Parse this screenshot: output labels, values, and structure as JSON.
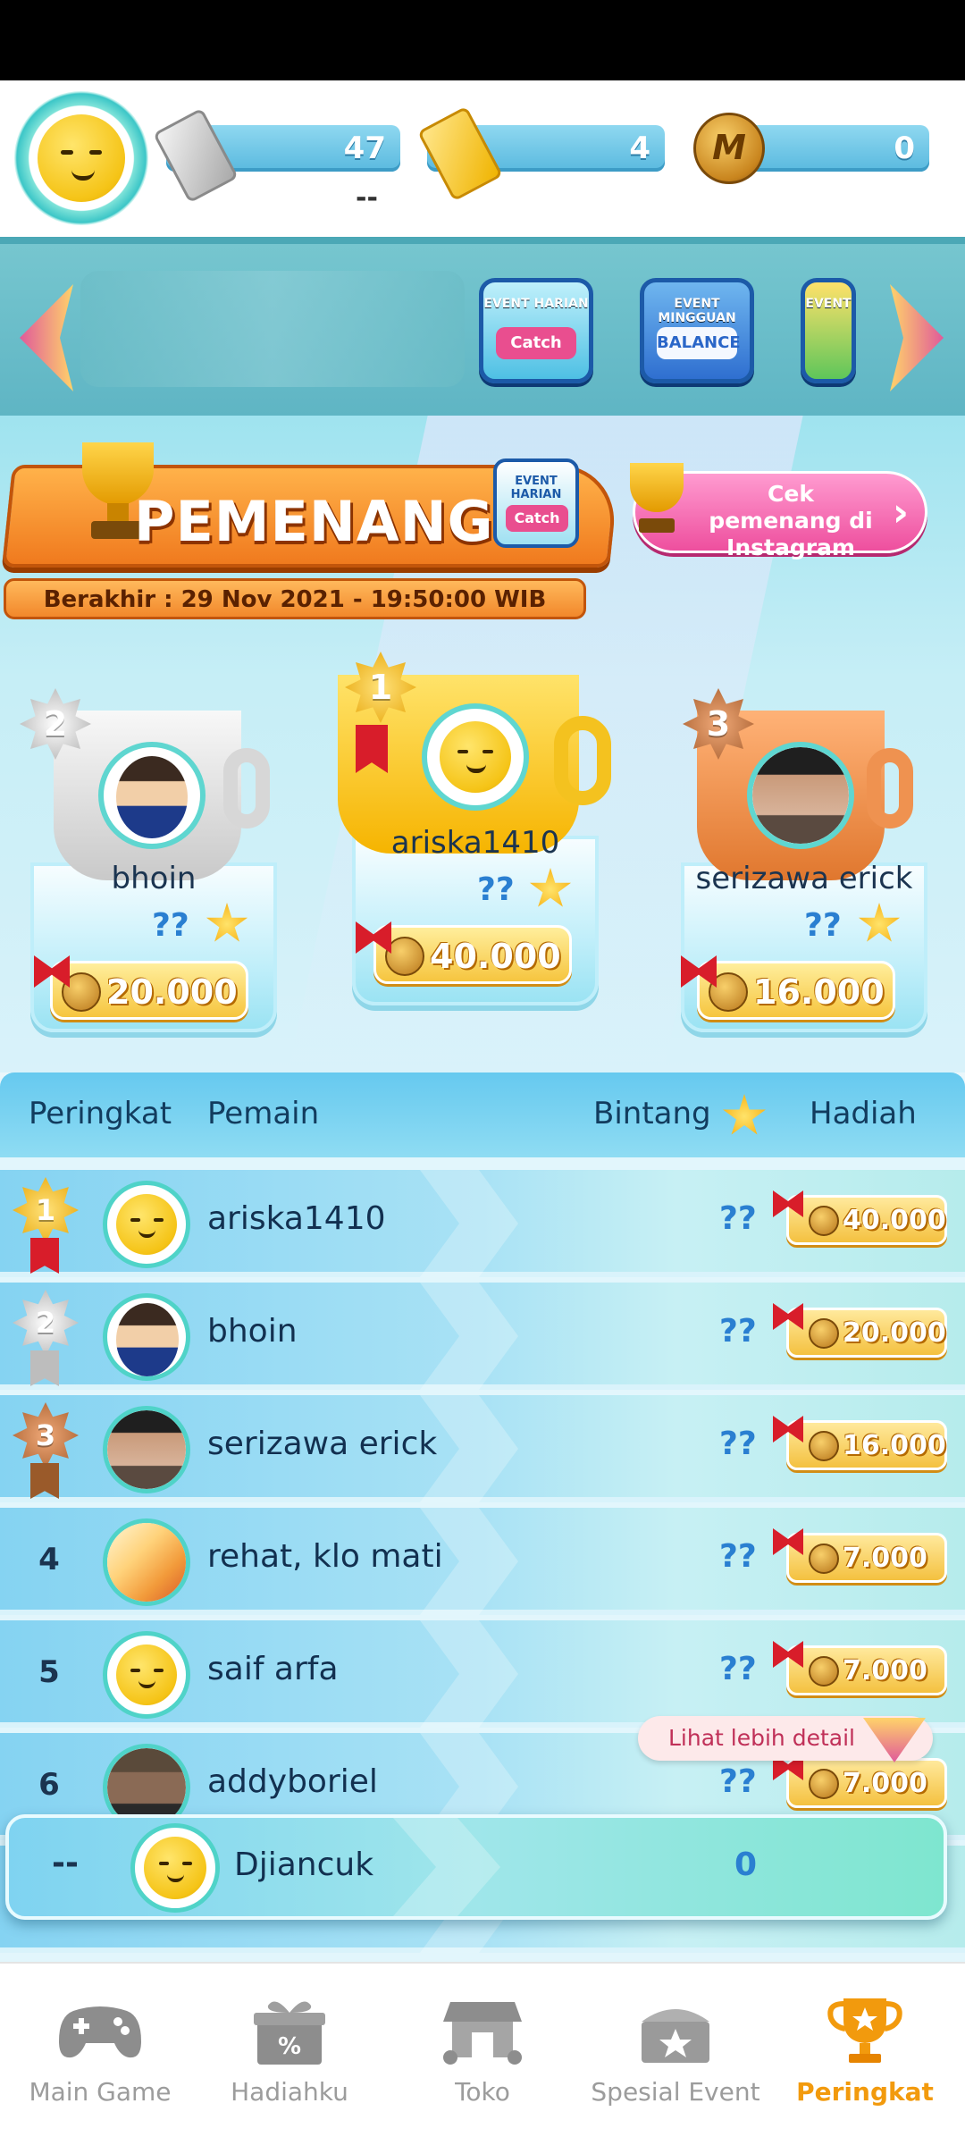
{
  "header": {
    "silver_ticket_count": "47",
    "gold_ticket_count": "4",
    "coin_count": "0",
    "silver_subtext": "--"
  },
  "events": [
    {
      "caption": "EVENT HARIAN",
      "badge": "Catch"
    },
    {
      "caption": "EVENT MINGGUAN",
      "badge": "BALANCE"
    },
    {
      "caption": "EVENT",
      "badge": ""
    }
  ],
  "winner_banner": {
    "title": "PEMENANG",
    "event_caption": "EVENT HARIAN",
    "event_badge": "Catch",
    "instagram_button": "Cek pemenang di Instagram",
    "ends": "Berakhir : 29 Nov 2021 - 19:50:00 WIB"
  },
  "podium": [
    {
      "rank": "2",
      "name": "bhoin",
      "stars": "??",
      "prize": "20.000"
    },
    {
      "rank": "1",
      "name": "ariska1410",
      "stars": "??",
      "prize": "40.000"
    },
    {
      "rank": "3",
      "name": "serizawa erick",
      "stars": "??",
      "prize": "16.000"
    }
  ],
  "leaderboard": {
    "headers": {
      "rank": "Peringkat",
      "player": "Pemain",
      "stars": "Bintang",
      "prize": "Hadiah"
    },
    "rows": [
      {
        "rank": "1",
        "name": "ariska1410",
        "stars": "??",
        "prize": "40.000"
      },
      {
        "rank": "2",
        "name": "bhoin",
        "stars": "??",
        "prize": "20.000"
      },
      {
        "rank": "3",
        "name": "serizawa erick",
        "stars": "??",
        "prize": "16.000"
      },
      {
        "rank": "4",
        "name": "rehat, klo mati",
        "stars": "??",
        "prize": "7.000"
      },
      {
        "rank": "5",
        "name": "saif arfa",
        "stars": "??",
        "prize": "7.000"
      },
      {
        "rank": "6",
        "name": "addyboriel",
        "stars": "??",
        "prize": "7.000"
      }
    ],
    "more_button": "Lihat lebih detail"
  },
  "me": {
    "rank": "--",
    "name": "Djiancuk",
    "stars": "0"
  },
  "nav": [
    {
      "label": "Main Game",
      "icon": "gamepad-icon"
    },
    {
      "label": "Hadiahku",
      "icon": "gift-icon"
    },
    {
      "label": "Toko",
      "icon": "store-icon"
    },
    {
      "label": "Spesial Event",
      "icon": "event-chest-icon"
    },
    {
      "label": "Peringkat",
      "icon": "trophy-icon"
    }
  ],
  "colors": {
    "active_nav": "#f29a0d",
    "accent_blue": "#59b9df",
    "banner_orange": "#f07a1e"
  }
}
